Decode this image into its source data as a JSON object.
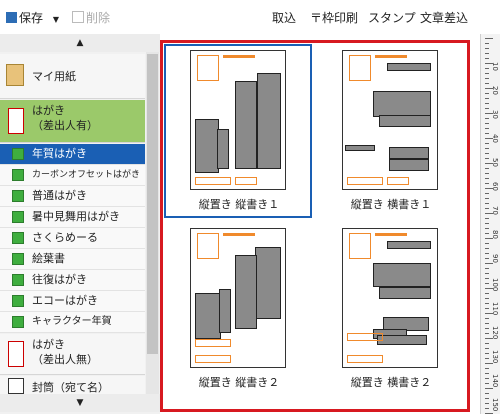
{
  "toolbar": {
    "save_label": "保存",
    "delete_label": "削除",
    "import_label": "取込",
    "frame_print_label": "〒枠印刷",
    "stamp_label": "スタンプ",
    "text_insert_label": "文章差込"
  },
  "sidebar": {
    "my_paper": "マイ用紙",
    "postcard_with_sender": "はがき\n（差出人有）",
    "postcard_items": [
      "年賀はがき",
      "カーボンオフセットはがき",
      "普通はがき",
      "暑中見舞用はがき",
      "さくらめーる",
      "絵葉書",
      "往復はがき",
      "エコーはがき",
      "キャラクター年賀"
    ],
    "postcard_no_sender": "はがき\n（差出人無）",
    "envelope": "封筒（宛て名）"
  },
  "templates": [
    {
      "label": "縦置き 縦書き１"
    },
    {
      "label": "縦置き 横書き１"
    },
    {
      "label": "縦置き 縦書き２"
    },
    {
      "label": "縦置き 横書き２"
    }
  ],
  "colors": {
    "accent_green": "#9bc96a",
    "selected_blue": "#1a5fb4",
    "highlight_red": "#d71920"
  },
  "ruler_numbers": [
    "10",
    "20",
    "30",
    "40",
    "50",
    "60",
    "70",
    "80",
    "90",
    "100",
    "110",
    "120",
    "130",
    "140",
    "150"
  ]
}
